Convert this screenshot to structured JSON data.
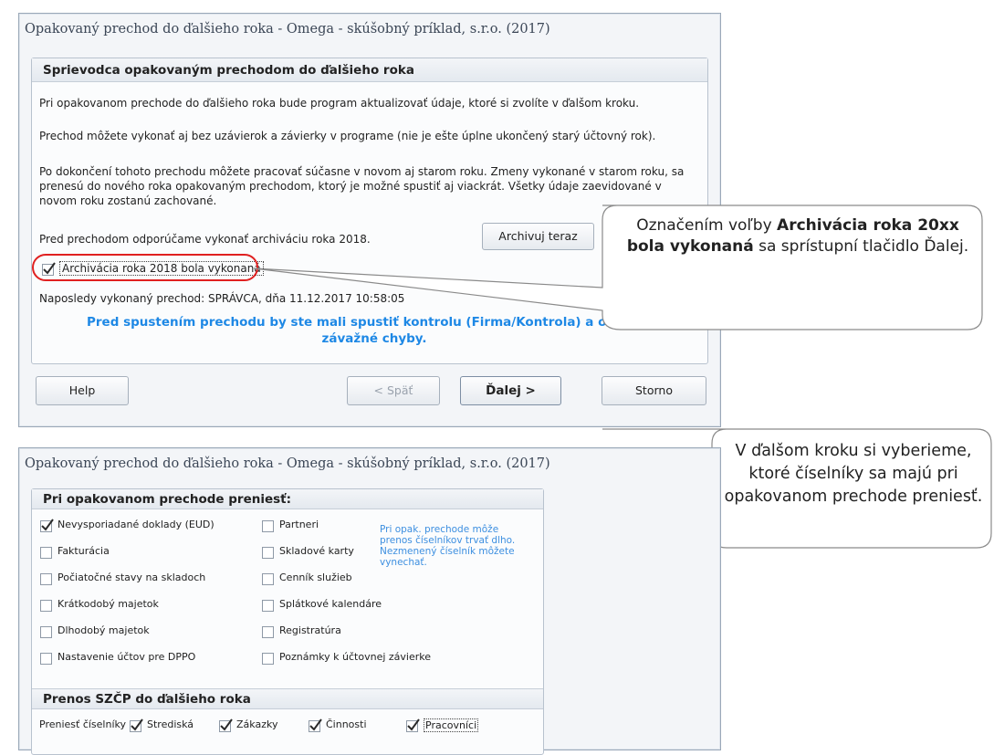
{
  "window1": {
    "title": "Opakovaný prechod do ďalšieho roka - Omega - skúšobný príklad, s.r.o. (2017)",
    "panel_header": "Sprievodca opakovaným prechodom do ďalšieho roka",
    "para1": "Pri opakovanom prechode do ďalšieho roka bude program aktualizovať údaje, ktoré si zvolíte v ďalšom kroku.",
    "para2": "Prechod môžete vykonať aj bez uzávierok a závierky v programe (nie je ešte úplne ukončený starý účtovný rok).",
    "para3": "Po dokončení tohoto prechodu môžete pracovať súčasne v novom aj starom roku. Zmeny vykonané v starom roku, sa prenesú do nového roka opakovaným prechodom, ktorý je možné spustiť aj viackrát. Všetky údaje zaevidované v novom roku zostanú zachované.",
    "archive_text": "Pred prechodom odporúčame vykonať archiváciu roka 2018.",
    "archive_button": "Archivuj teraz",
    "archive_checkbox_label": "Archivácia roka 2018 bola vykonaná",
    "archive_checked": true,
    "last_run": "Naposledy vykonaný prechod: SPRÁVCA, dňa 11.12.2017 10:58:05",
    "warning": "Pred spustením prechodu by ste mali spustiť kontrolu (Firma/Kontrola) a odstrániť závažné chyby.",
    "buttons": {
      "help": "Help",
      "back": "< Späť",
      "next": "Ďalej >",
      "cancel": "Storno"
    },
    "highlight_color": "#e02020"
  },
  "callout1": {
    "before": "Označením voľby ",
    "bold": "Archivácia roka 20xx bola vykonaná",
    "after": " sa sprístupní tlačidlo Ďalej."
  },
  "window2": {
    "title": "Opakovaný prechod do ďalšieho roka - Omega - skúšobný príklad, s.r.o. (2017)",
    "panel_header": "Pri opakovanom prechode preniesť:",
    "left_items": [
      {
        "label": "Nevysporiadané doklady (EUD)",
        "checked": true
      },
      {
        "label": "Fakturácia",
        "checked": false
      },
      {
        "label": "Počiatočné stavy na skladoch",
        "checked": false
      },
      {
        "label": "Krátkodobý majetok",
        "checked": false
      },
      {
        "label": "Dlhodobý majetok",
        "checked": false
      },
      {
        "label": "Nastavenie účtov pre DPPO",
        "checked": false
      }
    ],
    "right_items": [
      {
        "label": "Partneri",
        "checked": false
      },
      {
        "label": "Skladové karty",
        "checked": false
      },
      {
        "label": "Cenník služieb",
        "checked": false
      },
      {
        "label": "Splátkové kalendáre",
        "checked": false
      },
      {
        "label": "Registratúra",
        "checked": false
      },
      {
        "label": "Poznámky k účtovnej závierke",
        "checked": false
      }
    ],
    "note": "Pri opak. prechode môže prenos číselníkov trvať dlho. Nezmenený číselník môžete vynechať.",
    "szcp_header": "Prenos SZČP do ďalšieho roka",
    "szcp_label": "Preniesť číselníky",
    "szcp_items": [
      {
        "label": "Strediská",
        "checked": true
      },
      {
        "label": "Zákazky",
        "checked": true
      },
      {
        "label": "Činnosti",
        "checked": true
      },
      {
        "label": "Pracovníci",
        "checked": true
      }
    ]
  },
  "callout2": {
    "text": "V ďalšom kroku si vyberieme, ktoré číselníky sa majú pri opakovanom prechode preniesť."
  }
}
